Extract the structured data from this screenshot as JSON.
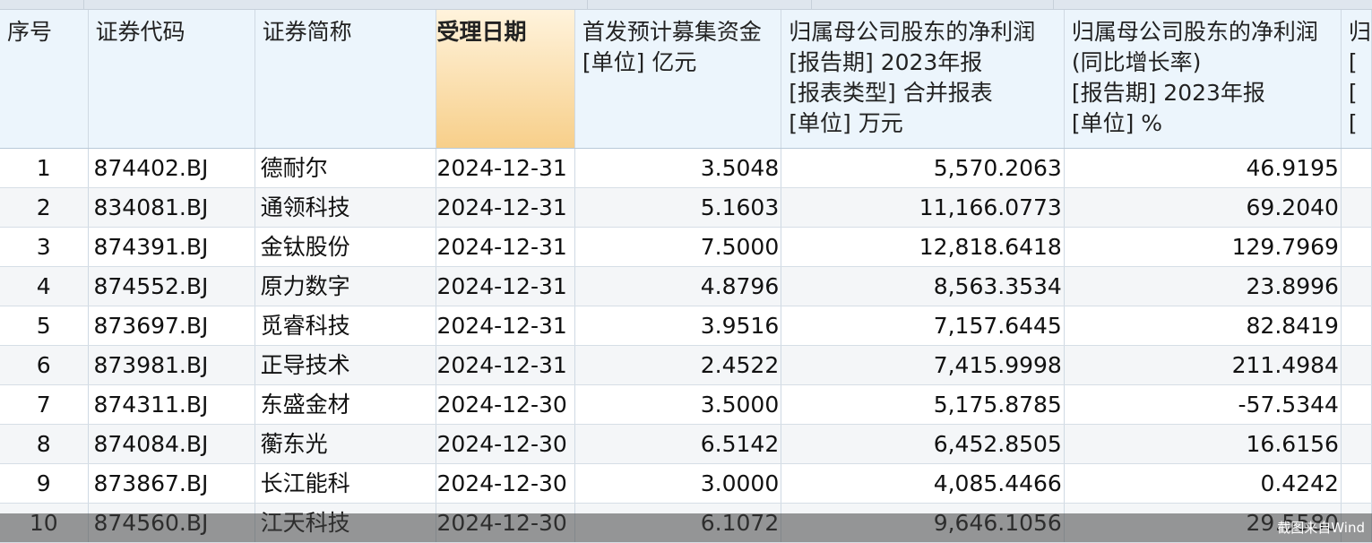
{
  "table": {
    "columns": [
      {
        "lines": [
          "序号"
        ]
      },
      {
        "lines": [
          "证券代码"
        ]
      },
      {
        "lines": [
          "证券简称"
        ]
      },
      {
        "lines": [
          "受理日期"
        ],
        "sorted": true
      },
      {
        "lines": [
          "首发预计募集资金",
          "[单位] 亿元"
        ]
      },
      {
        "lines": [
          "归属母公司股东的净利润",
          "[报告期] 2023年报",
          "[报表类型] 合并报表",
          "[单位] 万元"
        ]
      },
      {
        "lines": [
          "归属母公司股东的净利润",
          "(同比增长率)",
          "[报告期] 2023年报",
          "[单位] %"
        ]
      },
      {
        "lines": [
          "归",
          "[",
          "[",
          "["
        ]
      }
    ],
    "rows": [
      [
        "1",
        "874402.BJ",
        "德耐尔",
        "2024-12-31",
        "3.5048",
        "5,570.2063",
        "46.9195"
      ],
      [
        "2",
        "834081.BJ",
        "通领科技",
        "2024-12-31",
        "5.1603",
        "11,166.0773",
        "69.2040"
      ],
      [
        "3",
        "874391.BJ",
        "金钛股份",
        "2024-12-31",
        "7.5000",
        "12,818.6418",
        "129.7969"
      ],
      [
        "4",
        "874552.BJ",
        "原力数字",
        "2024-12-31",
        "4.8796",
        "8,563.3534",
        "23.8996"
      ],
      [
        "5",
        "873697.BJ",
        "觅睿科技",
        "2024-12-31",
        "3.9516",
        "7,157.6445",
        "82.8419"
      ],
      [
        "6",
        "873981.BJ",
        "正导技术",
        "2024-12-31",
        "2.4522",
        "7,415.9998",
        "211.4984"
      ],
      [
        "7",
        "874311.BJ",
        "东盛金材",
        "2024-12-30",
        "3.5000",
        "5,175.8785",
        "-57.5344"
      ],
      [
        "8",
        "874084.BJ",
        "蘅东光",
        "2024-12-30",
        "6.5142",
        "6,452.8505",
        "16.6156"
      ],
      [
        "9",
        "873867.BJ",
        "长江能科",
        "2024-12-30",
        "3.0000",
        "4,085.4466",
        "0.4242"
      ],
      [
        "10",
        "874560.BJ",
        "江天科技",
        "2024-12-30",
        "6.1072",
        "9,646.1056",
        "29.5580"
      ]
    ]
  },
  "watermark": "截图来自Wind"
}
